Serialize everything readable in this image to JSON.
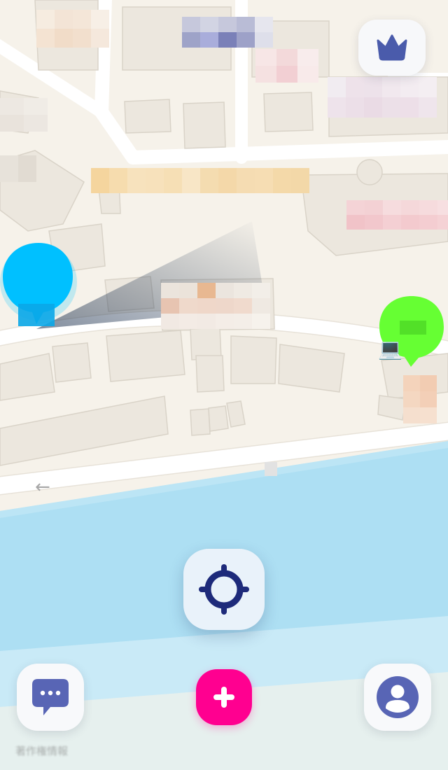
{
  "map": {
    "land_color": "#f6f2ea",
    "building_color": "#ece7de",
    "road_color": "#ffffff",
    "water_color": "#addff3",
    "street_direction_arrow": "←",
    "attribution": "著作権情報"
  },
  "markers": [
    {
      "name": "self-location-marker",
      "color": "#00c3ff",
      "icon": "speech-pin"
    },
    {
      "name": "friend-location-marker",
      "color": "#66ff33",
      "icon": "speech-pin",
      "device_icon": "laptop-icon",
      "device_glyph": "💻"
    }
  ],
  "controls": {
    "premium": {
      "icon": "crown-icon",
      "color": "#4a5bab"
    },
    "recenter": {
      "icon": "crosshair-icon",
      "color": "#1d2a7a"
    },
    "chat": {
      "icon": "chat-bubble-icon",
      "color": "#5865b5"
    },
    "add": {
      "icon": "plus-icon",
      "color": "#ff0090"
    },
    "profile": {
      "icon": "user-icon",
      "color": "#5865b5"
    }
  }
}
